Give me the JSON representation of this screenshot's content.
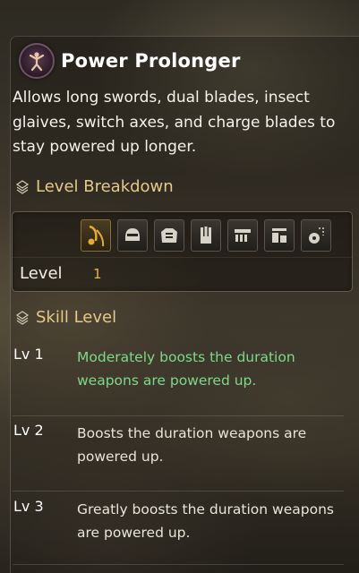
{
  "skill": {
    "icon": "power-prolonger-icon",
    "title": "Power Prolonger",
    "description": "Allows long swords, dual blades, insect glaives, switch axes, and charge blades to stay powered up longer."
  },
  "level_breakdown": {
    "label": "Level Breakdown",
    "gear_slots": [
      "weapon-icon",
      "helm-icon",
      "chest-icon",
      "arms-icon",
      "waist-icon",
      "legs-icon",
      "charm-icon"
    ],
    "level_label": "Level",
    "level_value": "1"
  },
  "skill_level": {
    "label": "Skill Level",
    "levels": [
      {
        "name": "Lv 1",
        "desc": "Moderately boosts the duration weapons are powered up.",
        "active": true
      },
      {
        "name": "Lv 2",
        "desc": "Boosts the duration weapons are powered up.",
        "active": false
      },
      {
        "name": "Lv 3",
        "desc": "Greatly boosts the duration weapons are powered up.",
        "active": false
      }
    ]
  },
  "colors": {
    "section_gold": "#e3c98a",
    "active_green": "#7ed88a",
    "level_orange": "#e8b64e"
  }
}
